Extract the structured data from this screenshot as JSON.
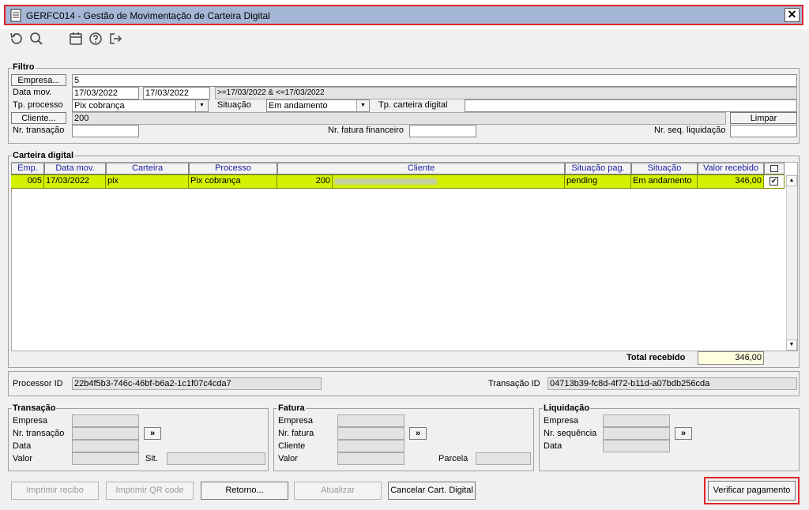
{
  "window": {
    "title": "GERFC014 - Gestão de Movimentação de Carteira Digital",
    "close": "✕"
  },
  "toolbar": {
    "icons": [
      "undo-icon",
      "search-icon",
      "calendar-icon",
      "help-icon",
      "exit-icon"
    ]
  },
  "filtro": {
    "label": "Filtro",
    "empresa_btn": "Empresa...",
    "empresa_value": "5",
    "data_mov_label": "Data mov.",
    "data_from": "17/03/2022",
    "data_to": "17/03/2022",
    "data_expr": ">=17/03/2022 & <=17/03/2022",
    "tp_processo_label": "Tp. processo",
    "tp_processo_value": "Pix cobrança",
    "situacao_label": "Situação",
    "situacao_value": "Em andamento",
    "tp_carteira_label": "Tp. carteira digital",
    "tp_carteira_value": "",
    "cliente_btn": "Cliente...",
    "cliente_value": "200",
    "limpar_btn": "Limpar",
    "nr_transacao_label": "Nr. transação",
    "nr_fatura_label": "Nr. fatura financeiro",
    "nr_seq_label": "Nr. seq. liquidação"
  },
  "carteira": {
    "label": "Carteira digital",
    "columns": [
      "Emp.",
      "Data mov.",
      "Carteira",
      "Processo",
      "Cliente",
      "Situação pag.",
      "Situação",
      "Valor recebido"
    ],
    "rows": [
      {
        "emp": "005",
        "data": "17/03/2022",
        "carteira": "pix",
        "processo": "Pix cobrança",
        "cliente": "200",
        "sit_pag": "pending",
        "situacao": "Em andamento",
        "valor": "346,00",
        "checked": "✔"
      }
    ],
    "total_label": "Total recebido",
    "total_value": "346,00"
  },
  "ids": {
    "processor_label": "Processor ID",
    "processor_value": "22b4f5b3-746c-46bf-b6a2-1c1f07c4cda7",
    "transacao_label": "Transação ID",
    "transacao_value": "04713b39-fc8d-4f72-b11d-a07bdb256cda"
  },
  "transacao": {
    "label": "Transação",
    "empresa": "Empresa",
    "nr": "Nr. transação",
    "data": "Data",
    "valor": "Valor",
    "sit": "Sit.",
    "go": "»"
  },
  "fatura": {
    "label": "Fatura",
    "empresa": "Empresa",
    "nr": "Nr. fatura",
    "cliente": "Cliente",
    "valor": "Valor",
    "parcela": "Parcela",
    "go": "»"
  },
  "liquidacao": {
    "label": "Liquidação",
    "empresa": "Empresa",
    "nr": "Nr. sequência",
    "data": "Data",
    "go": "»"
  },
  "buttons": {
    "imprimir_recibo": "Imprimir recibo",
    "imprimir_qr": "Imprimir QR code",
    "retorno": "Retorno...",
    "atualizar": "Atualizar",
    "cancelar": "Cancelar Cart. Digital",
    "verificar": "Verificar pagamento"
  }
}
